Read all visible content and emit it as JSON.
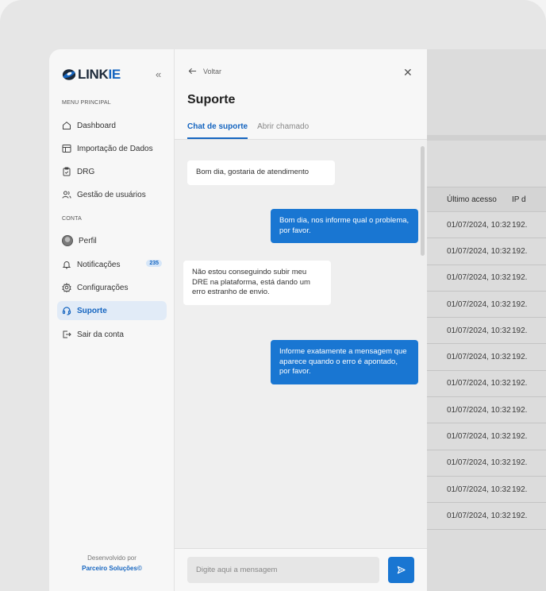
{
  "app": {
    "logo_prefix": "LINK",
    "logo_suffix": "IE",
    "accent": "#1565c0"
  },
  "sidebar": {
    "section_main": "MENU PRINCIPAL",
    "section_account": "CONTA",
    "items": [
      {
        "label": "Dashboard",
        "icon": "home-icon"
      },
      {
        "label": "Importação de Dados",
        "icon": "table-icon"
      },
      {
        "label": "DRG",
        "icon": "clipboard-icon"
      },
      {
        "label": "Gestão de usuários",
        "icon": "users-icon"
      },
      {
        "label": "Perfil",
        "icon": "avatar"
      },
      {
        "label": "Notificações",
        "icon": "bell-icon",
        "badge": "235"
      },
      {
        "label": "Configurações",
        "icon": "gear-icon"
      },
      {
        "label": "Suporte",
        "icon": "headset-icon",
        "active": true
      },
      {
        "label": "Sair da conta",
        "icon": "logout-icon"
      }
    ],
    "footer_text": "Desenvolvido por",
    "footer_brand": "Parceiro Soluções©"
  },
  "panel": {
    "back_label": "Voltar",
    "title": "Suporte",
    "tabs": [
      {
        "label": "Chat de suporte",
        "active": true
      },
      {
        "label": "Abrir chamado"
      }
    ],
    "messages": [
      {
        "from": "user",
        "text": "Bom dia, gostaria de atendimento"
      },
      {
        "from": "support",
        "text": "Bom dia, nos informe qual o problema, por favor."
      },
      {
        "from": "user",
        "text": "Não estou conseguindo subir meu DRE na plataforma, está dando um erro estranho de envio."
      },
      {
        "from": "support",
        "text": "Informe exatamente a mensagem que aparece quando o erro é apontado, por favor."
      }
    ],
    "input_placeholder": "Digite aqui a mensagem"
  },
  "background_table": {
    "headers": [
      "Último acesso",
      "IP d"
    ],
    "rows": [
      [
        "01/07/2024, 10:32",
        "192."
      ],
      [
        "01/07/2024, 10:32",
        "192."
      ],
      [
        "01/07/2024, 10:32",
        "192."
      ],
      [
        "01/07/2024, 10:32",
        "192."
      ],
      [
        "01/07/2024, 10:32",
        "192."
      ],
      [
        "01/07/2024, 10:32",
        "192."
      ],
      [
        "01/07/2024, 10:32",
        "192."
      ],
      [
        "01/07/2024, 10:32",
        "192."
      ],
      [
        "01/07/2024, 10:32",
        "192."
      ],
      [
        "01/07/2024, 10:32",
        "192."
      ],
      [
        "01/07/2024, 10:32",
        "192."
      ],
      [
        "01/07/2024, 10:32",
        "192."
      ]
    ]
  }
}
